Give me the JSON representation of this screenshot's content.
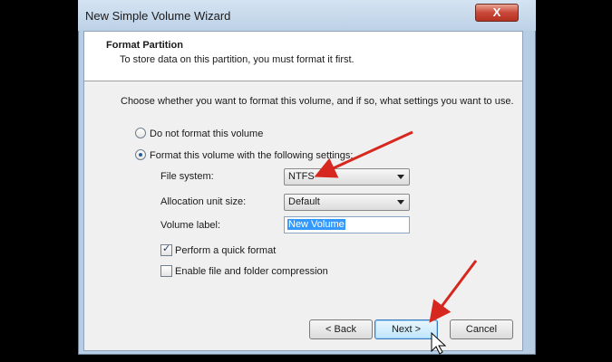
{
  "window": {
    "title": "New Simple Volume Wizard",
    "close_label": "X"
  },
  "header": {
    "title": "Format Partition",
    "subtitle": "To store data on this partition, you must format it first."
  },
  "instruction": "Choose whether you want to format this volume, and if so, what settings you want to use.",
  "options": {
    "no_format": {
      "label": "Do not format this volume",
      "selected": false
    },
    "format": {
      "label": "Format this volume with the following settings:",
      "selected": true
    }
  },
  "settings": {
    "file_system": {
      "label": "File system:",
      "value": "NTFS"
    },
    "allocation": {
      "label": "Allocation unit size:",
      "value": "Default"
    },
    "volume_label": {
      "label": "Volume label:",
      "value": "New Volume"
    }
  },
  "checkboxes": {
    "quick_format": {
      "label": "Perform a quick format",
      "checked": true
    },
    "compression": {
      "label": "Enable file and folder compression",
      "checked": false
    }
  },
  "buttons": {
    "back": "< Back",
    "next": "Next >",
    "cancel": "Cancel"
  },
  "colors": {
    "annotation_arrow": "#d6281f",
    "selection": "#3399ff"
  }
}
